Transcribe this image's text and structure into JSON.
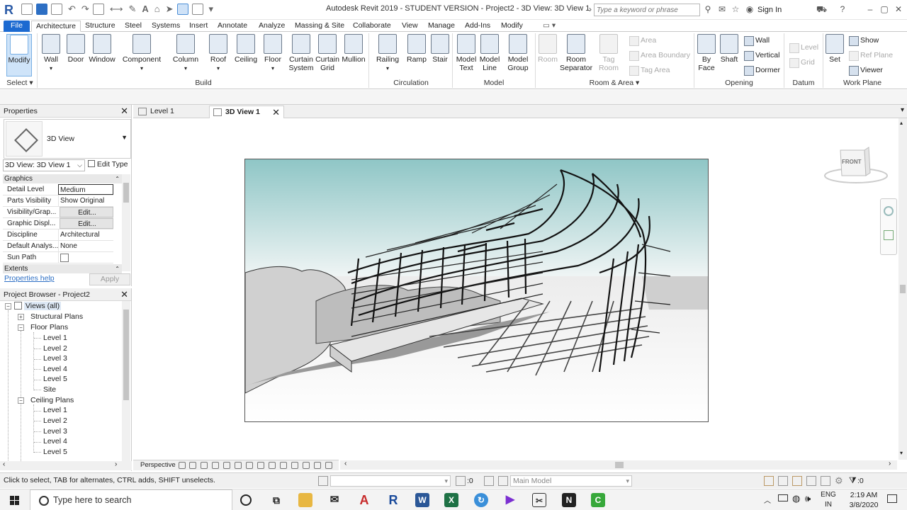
{
  "window": {
    "title": "Autodesk Revit 2019 - STUDENT VERSION - Project2 - 3D View: 3D View 1",
    "search_placeholder": "Type a keyword or phrase",
    "sign_in": "Sign In"
  },
  "ribbon_tabs": [
    "File",
    "Architecture",
    "Structure",
    "Steel",
    "Systems",
    "Insert",
    "Annotate",
    "Analyze",
    "Massing & Site",
    "Collaborate",
    "View",
    "Manage",
    "Add-Ins",
    "Modify"
  ],
  "active_tab": "Architecture",
  "ribbon": {
    "select": {
      "modify": "Modify",
      "label": "Select"
    },
    "build": {
      "label": "Build",
      "buttons": [
        "Wall",
        "Door",
        "Window",
        "Component",
        "Column",
        "Roof",
        "Ceiling",
        "Floor",
        "Curtain System",
        "Curtain Grid",
        "Mullion"
      ]
    },
    "circulation": {
      "label": "Circulation",
      "buttons": [
        "Railing",
        "Ramp",
        "Stair"
      ]
    },
    "model": {
      "label": "Model",
      "buttons": [
        "Model Text",
        "Model Line",
        "Model Group"
      ]
    },
    "room_area": {
      "label": "Room & Area",
      "buttons": [
        "Room",
        "Room Separator",
        "Tag Room"
      ],
      "small": [
        "Area",
        "Area Boundary",
        "Tag Area"
      ]
    },
    "opening": {
      "label": "Opening",
      "buttons": [
        "By Face",
        "Shaft"
      ],
      "small": [
        "Wall",
        "Vertical",
        "Dormer"
      ]
    },
    "datum": {
      "label": "Datum",
      "small": [
        "Level",
        "Grid"
      ]
    },
    "work_plane": {
      "label": "Work Plane",
      "set": "Set",
      "small": [
        "Show",
        "Ref Plane",
        "Viewer"
      ]
    }
  },
  "properties": {
    "header": "Properties",
    "type_name": "3D View",
    "instance_selector": "3D View: 3D View 1",
    "edit_type": "Edit Type",
    "group_graphics": "Graphics",
    "rows": [
      {
        "key": "Detail Level",
        "value": "Medium"
      },
      {
        "key": "Parts Visibility",
        "value": "Show Original"
      },
      {
        "key": "Visibility/Grap...",
        "value": "Edit..."
      },
      {
        "key": "Graphic Displ...",
        "value": "Edit..."
      },
      {
        "key": "Discipline",
        "value": "Architectural"
      },
      {
        "key": "Default Analys...",
        "value": "None"
      },
      {
        "key": "Sun Path",
        "value": ""
      }
    ],
    "group_extents": "Extents",
    "help_link": "Properties help",
    "apply": "Apply"
  },
  "browser": {
    "header": "Project Browser - Project2",
    "views_root": "Views (all)",
    "structural_plans": "Structural Plans",
    "floor_plans": "Floor Plans",
    "floor_items": [
      "Level 1",
      "Level 2",
      "Level 3",
      "Level 4",
      "Level 5",
      "Site"
    ],
    "ceiling_plans": "Ceiling Plans",
    "ceiling_items": [
      "Level 1",
      "Level 2",
      "Level 3",
      "Level 4",
      "Level 5"
    ]
  },
  "view_tabs": [
    {
      "label": "Level 1"
    },
    {
      "label": "3D View 1"
    }
  ],
  "view_control": {
    "projection": "Perspective"
  },
  "status": {
    "message": "Click to select, TAB for alternates, CTRL adds, SHIFT unselects.",
    "worksets_count": ":0",
    "model_name": "Main Model",
    "filter_count": ":0"
  },
  "viewcube": {
    "face": "FRONT"
  },
  "taskbar": {
    "search_placeholder": "Type here to search",
    "lang_line1": "ENG",
    "lang_line2": "IN",
    "time": "2:19 AM",
    "date": "3/8/2020"
  },
  "colors": {
    "file_tab": "#1c6ad1",
    "sky_top": "#8fc6c6",
    "link": "#2d6fc4"
  }
}
